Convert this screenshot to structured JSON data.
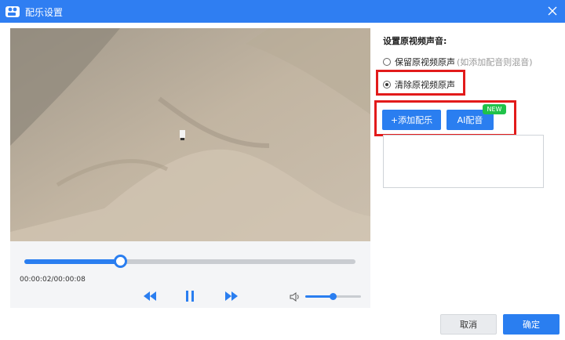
{
  "window": {
    "title": "配乐设置",
    "app_icon": "camera-icon",
    "close_icon": "close-icon"
  },
  "player": {
    "timecode": "00:00:02/00:00:08",
    "progress_fraction": 0.29,
    "volume_fraction": 0.5,
    "controls": [
      "rewind-icon",
      "pause-icon",
      "forward-icon",
      "volume-icon"
    ]
  },
  "audio_settings": {
    "heading": "设置原视频声音:",
    "options": [
      {
        "label": "保留原视频原声",
        "hint": "(如添加配音则混音)",
        "checked": false
      },
      {
        "label": "清除原视频原声",
        "hint": "",
        "checked": true
      }
    ]
  },
  "music": {
    "add_button": "+添加配乐",
    "ai_button": "AI配音",
    "new_badge": "NEW"
  },
  "footer": {
    "cancel": "取消",
    "ok": "确定"
  },
  "colors": {
    "accent": "#2a7ef0",
    "titlebar": "#2f7ef2",
    "highlight": "#e21b1b",
    "badge": "#20c24a"
  }
}
